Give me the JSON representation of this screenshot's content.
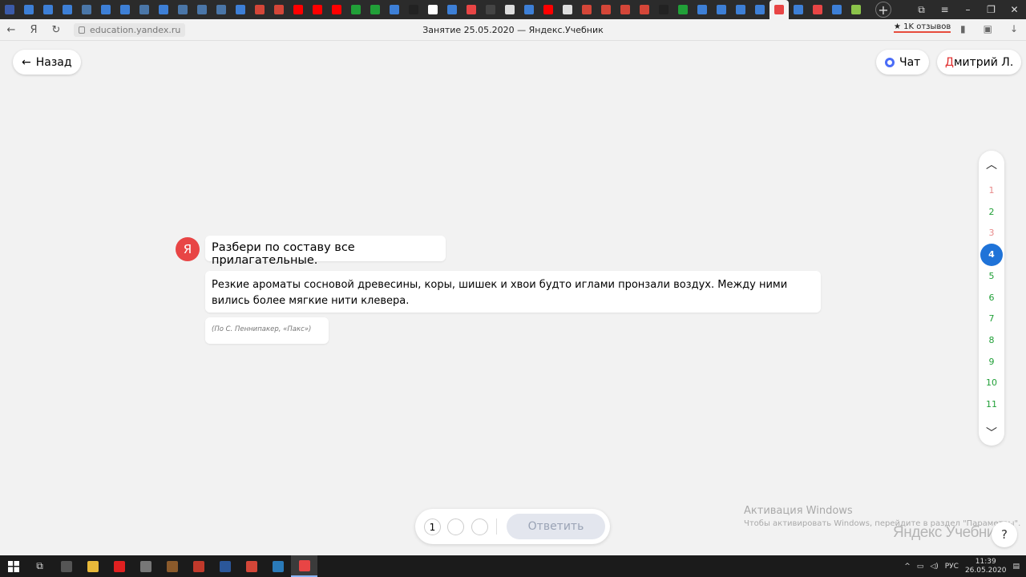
{
  "browser": {
    "url": "education.yandex.ru",
    "title": "Занятие 25.05.2020 — Яндекс.Учебник",
    "reviews": "★ 1K отзывов",
    "tab_colors": [
      "#3b5ba9",
      "#3d7fd6",
      "#3d7fd6",
      "#3d7fd6",
      "#4a76a8",
      "#3d7fd6",
      "#3d7fd6",
      "#4a76a8",
      "#3d7fd6",
      "#4a76a8",
      "#4a76a8",
      "#4a76a8",
      "#3d7fd6",
      "#d44638",
      "#d44638",
      "#ff0000",
      "#ff0000",
      "#ff0000",
      "#21a038",
      "#21a038",
      "#3d7fd6",
      "#222222",
      "#ffffff",
      "#3d7fd6",
      "#e84545",
      "#444444",
      "#dddddd",
      "#3d7fd6",
      "#ff0000",
      "#dddddd",
      "#d44638",
      "#d44638",
      "#d44638",
      "#d44638",
      "#222222",
      "#21a038",
      "#3d7fd6",
      "#3d7fd6",
      "#3d7fd6",
      "#3d7fd6",
      "#e84545",
      "#3d7fd6",
      "#e84545",
      "#3d7fd6",
      "#8bc34a"
    ]
  },
  "header": {
    "back_label": "Назад",
    "chat_label": "Чат",
    "user_first": "Д",
    "user_rest": "митрий Л."
  },
  "task": {
    "logo": "Я",
    "question": "Разбери по составу все прилагательные.",
    "text": "Резкие ароматы сосновой древесины, коры, шишек и хвои будто иглами пронзали воздух. Между ними вились более мягкие нити клевера.",
    "source": "(По С. Пеннипакер, «Пакс»)"
  },
  "navigator": {
    "items": [
      {
        "n": "1",
        "state": "red"
      },
      {
        "n": "2",
        "state": "green"
      },
      {
        "n": "3",
        "state": "red"
      },
      {
        "n": "4",
        "state": "current"
      },
      {
        "n": "5",
        "state": "green"
      },
      {
        "n": "6",
        "state": "green"
      },
      {
        "n": "7",
        "state": "green"
      },
      {
        "n": "8",
        "state": "green"
      },
      {
        "n": "9",
        "state": "green"
      },
      {
        "n": "10",
        "state": "green"
      },
      {
        "n": "11",
        "state": "green"
      }
    ]
  },
  "answer": {
    "attempt_1": "1",
    "submit_label": "Ответить"
  },
  "watermark": {
    "line1": "Активация Windows",
    "line2": "Чтобы активировать Windows, перейдите в раздел \"Параметры\"."
  },
  "brand": "Яндекс Учебник",
  "help": "?",
  "taskbar": {
    "apps": [
      "#555555",
      "#e8b93a",
      "#e02020",
      "#777777",
      "#8b5a2b",
      "#c0392b",
      "#2b579a",
      "#d44638",
      "#2a7ab8",
      "#e84545"
    ],
    "lang": "РУС",
    "time": "11:39",
    "date": "26.05.2020"
  }
}
